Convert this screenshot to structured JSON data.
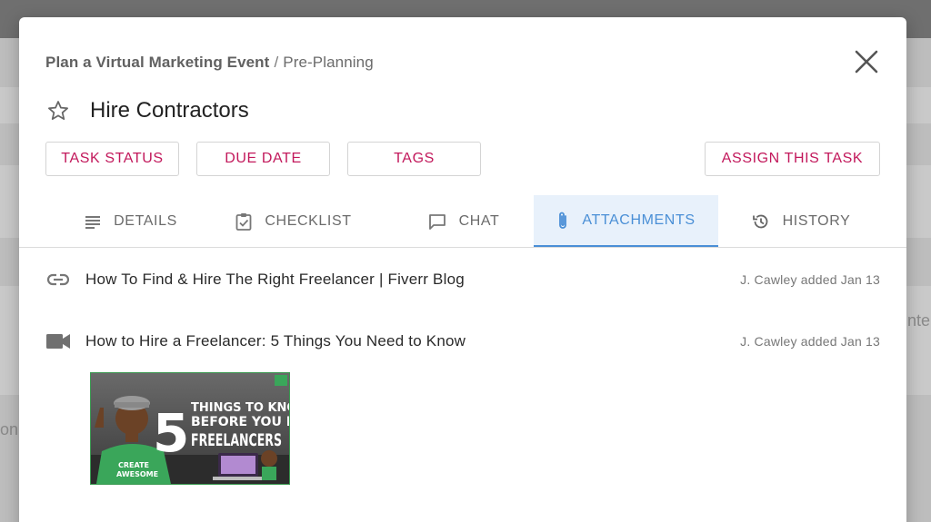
{
  "breadcrumb": {
    "project": "Plan a Virtual Marketing Event",
    "separator": "/",
    "section": "Pre-Planning"
  },
  "task": {
    "title": "Hire Contractors"
  },
  "actions": {
    "task_status": "TASK STATUS",
    "due_date": "DUE DATE",
    "tags": "TAGS",
    "assign": "ASSIGN THIS TASK"
  },
  "tabs": [
    {
      "label": "DETAILS",
      "icon": "list-icon"
    },
    {
      "label": "CHECKLIST",
      "icon": "checklist-icon"
    },
    {
      "label": "CHAT",
      "icon": "chat-icon"
    },
    {
      "label": "ATTACHMENTS",
      "icon": "paperclip-icon",
      "active": true
    },
    {
      "label": "HISTORY",
      "icon": "history-icon"
    }
  ],
  "attachments": [
    {
      "type": "link",
      "icon": "link-icon",
      "title": "How To Find & Hire The Right Freelancer | Fiverr Blog",
      "meta": "J. Cawley added Jan 13"
    },
    {
      "type": "video",
      "icon": "video-icon",
      "title": "How to Hire a Freelancer: 5 Things You Need to Know",
      "meta": "J. Cawley added Jan 13"
    }
  ],
  "thumbnail": {
    "number": "5",
    "line1": "THINGS TO KNOW",
    "line2": "BEFORE YOU HIRE",
    "line3": "FREELANCERS",
    "shirt_line1": "CREATE",
    "shirt_line2": "AWESOME"
  },
  "backdrop": {
    "right_fragment": "nte",
    "left_fragment": "on"
  },
  "colors": {
    "accent_pink": "#c2185b",
    "accent_blue": "#4a8fd6",
    "active_tab_bg": "#e8f1fb"
  }
}
